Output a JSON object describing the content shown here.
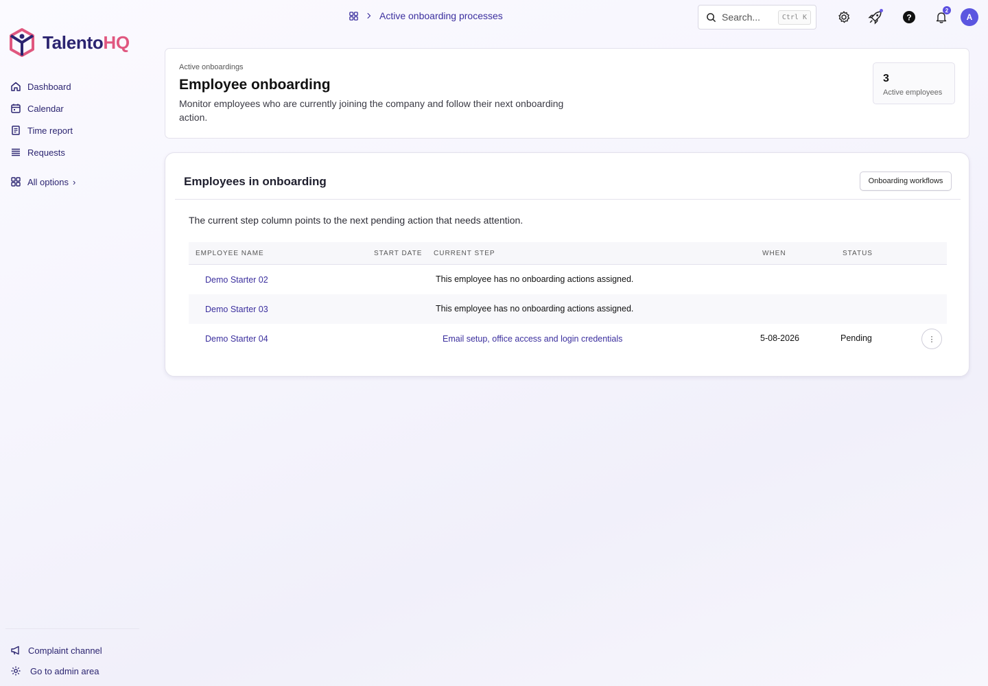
{
  "brand": {
    "name_main": "Talento",
    "name_accent": "HQ",
    "accent_color": "#e0577f",
    "primary_color": "#2b2470"
  },
  "sidebar": {
    "items": [
      {
        "label": "Dashboard",
        "icon": "home-icon"
      },
      {
        "label": "Calendar",
        "icon": "calendar-icon"
      },
      {
        "label": "Time report",
        "icon": "document-icon"
      },
      {
        "label": "Requests",
        "icon": "list-icon"
      }
    ],
    "all_options": {
      "label": "All options",
      "chevron": "›"
    },
    "bottom": [
      {
        "label": "Complaint channel",
        "icon": "megaphone-icon"
      },
      {
        "label": "Go to admin area",
        "icon": "gear-icon"
      }
    ]
  },
  "topbar": {
    "breadcrumb": {
      "current": "Active onboarding processes"
    },
    "search": {
      "placeholder": "Search...",
      "shortcut": "Ctrl K"
    },
    "notifications_count": "2",
    "avatar_initial": "A"
  },
  "header": {
    "eyebrow": "Active onboardings",
    "title": "Employee onboarding",
    "description": "Monitor employees who are currently joining the company and follow their next onboarding action.",
    "stat": {
      "value": "3",
      "label": "Active employees"
    }
  },
  "section": {
    "title": "Employees in onboarding",
    "workflows_button": "Onboarding workflows",
    "hint": "The current step column points to the next pending action that needs attention."
  },
  "table": {
    "columns": [
      "Employee name",
      "Start date",
      "Current step",
      "When",
      "Status"
    ],
    "rows": [
      {
        "name": "Demo Starter 02",
        "start_date": "",
        "step": "This employee has no onboarding actions assigned.",
        "when": "",
        "status": ""
      },
      {
        "name": "Demo Starter 03",
        "start_date": "",
        "step": "This employee has no onboarding actions assigned.",
        "when": "",
        "status": ""
      },
      {
        "name": "Demo Starter 04",
        "start_date": "",
        "step": "Email setup, office access and login credentials",
        "when": "5-08-2026",
        "status": "Pending"
      }
    ],
    "row_menu_glyph": "⋮"
  }
}
